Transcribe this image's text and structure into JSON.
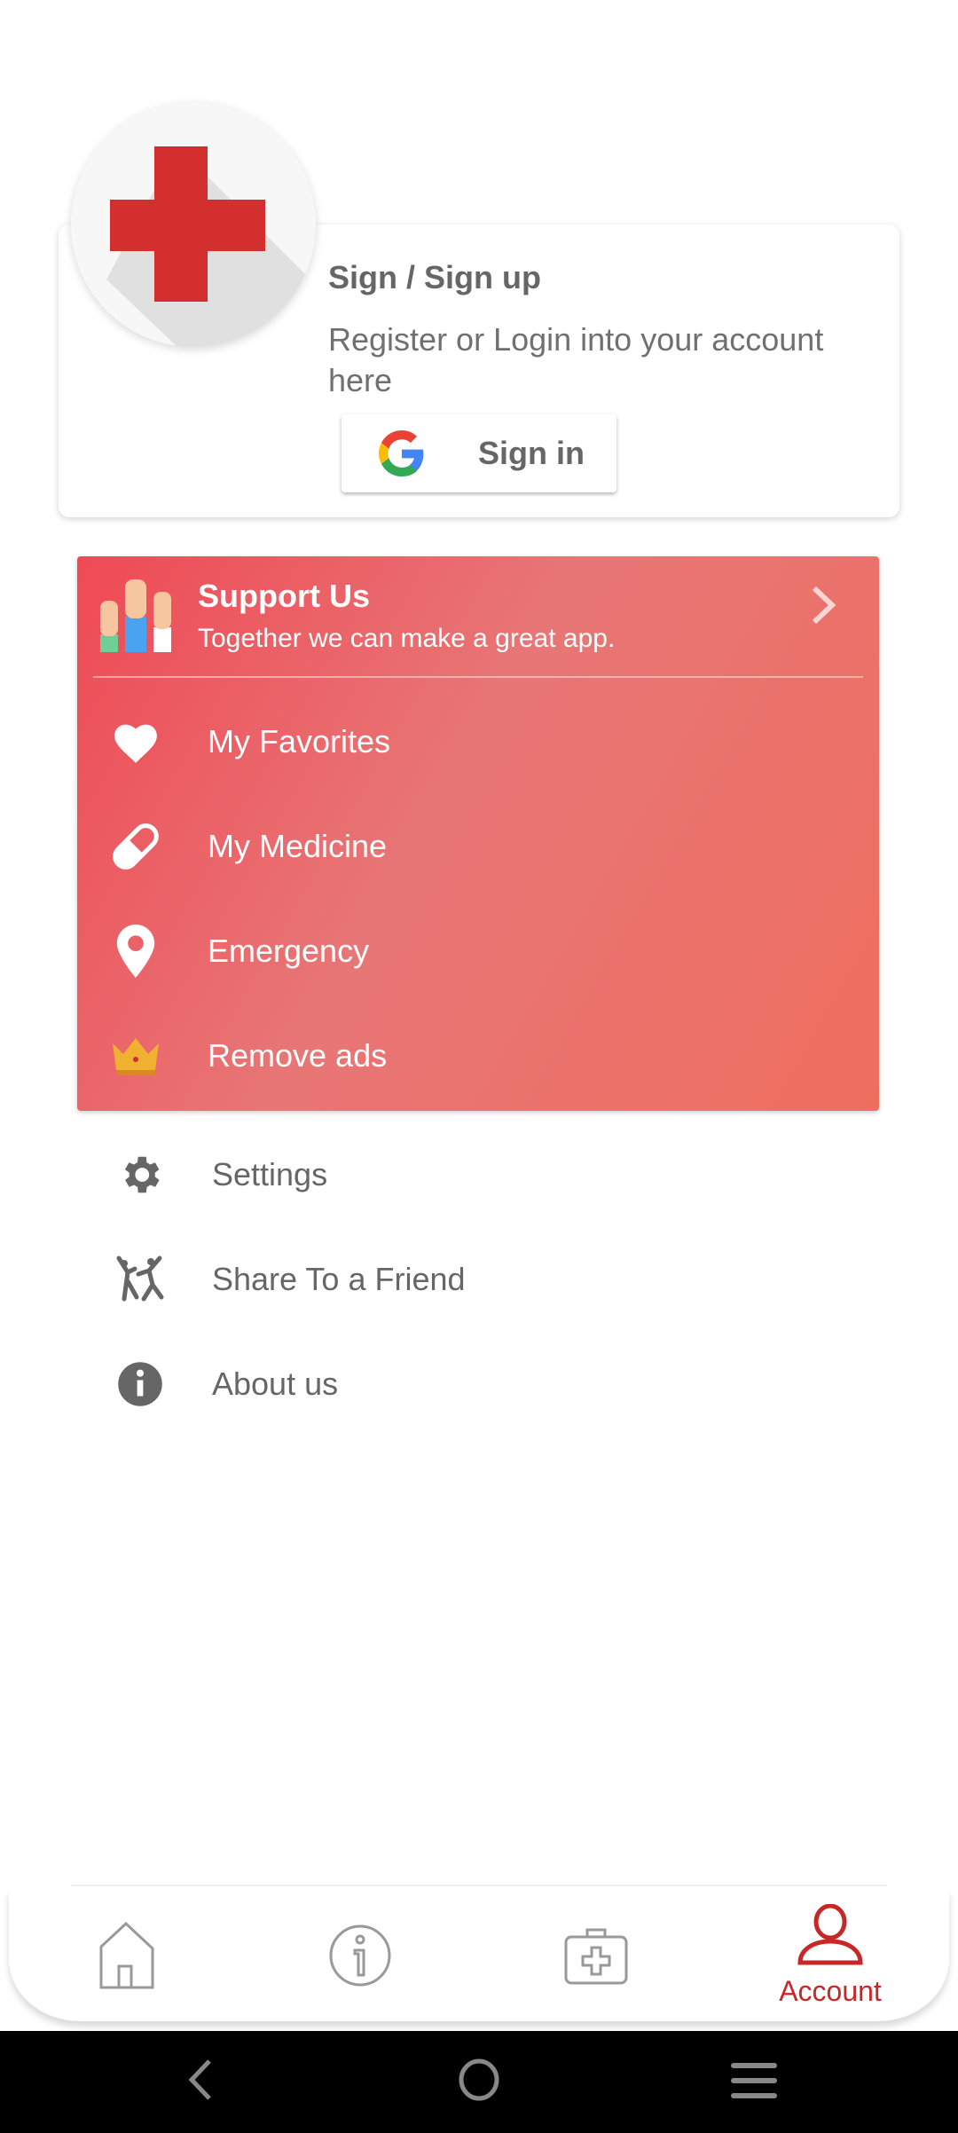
{
  "account_card": {
    "title": "Sign / Sign up",
    "description": "Register or Login into your account here",
    "sign_in_label": "Sign in",
    "logo_icon": "red-cross-icon",
    "logo_color": "#d32f2f"
  },
  "support": {
    "title": "Support Us",
    "subtitle": "Together we can make a great app.",
    "icon": "raised-hands-icon"
  },
  "panel_items": [
    {
      "label": "My Favorites",
      "icon": "heart-icon"
    },
    {
      "label": "My Medicine",
      "icon": "pill-icon"
    },
    {
      "label": "Emergency",
      "icon": "location-pin-icon"
    },
    {
      "label": "Remove ads",
      "icon": "crown-icon"
    }
  ],
  "menu_items": [
    {
      "label": "Settings",
      "icon": "gear-icon"
    },
    {
      "label": "Share To a Friend",
      "icon": "friends-icon"
    },
    {
      "label": "About us",
      "icon": "info-icon"
    }
  ],
  "bottom_nav": {
    "items": [
      {
        "icon": "home-icon"
      },
      {
        "icon": "info-icon"
      },
      {
        "icon": "first-aid-kit-icon"
      },
      {
        "icon": "account-icon",
        "label": "Account",
        "active": true
      }
    ],
    "active_color": "#c62828",
    "inactive_color": "#999999"
  },
  "panel_gradient": [
    "#ee4a55",
    "#e87676",
    "#ee6e5e"
  ]
}
